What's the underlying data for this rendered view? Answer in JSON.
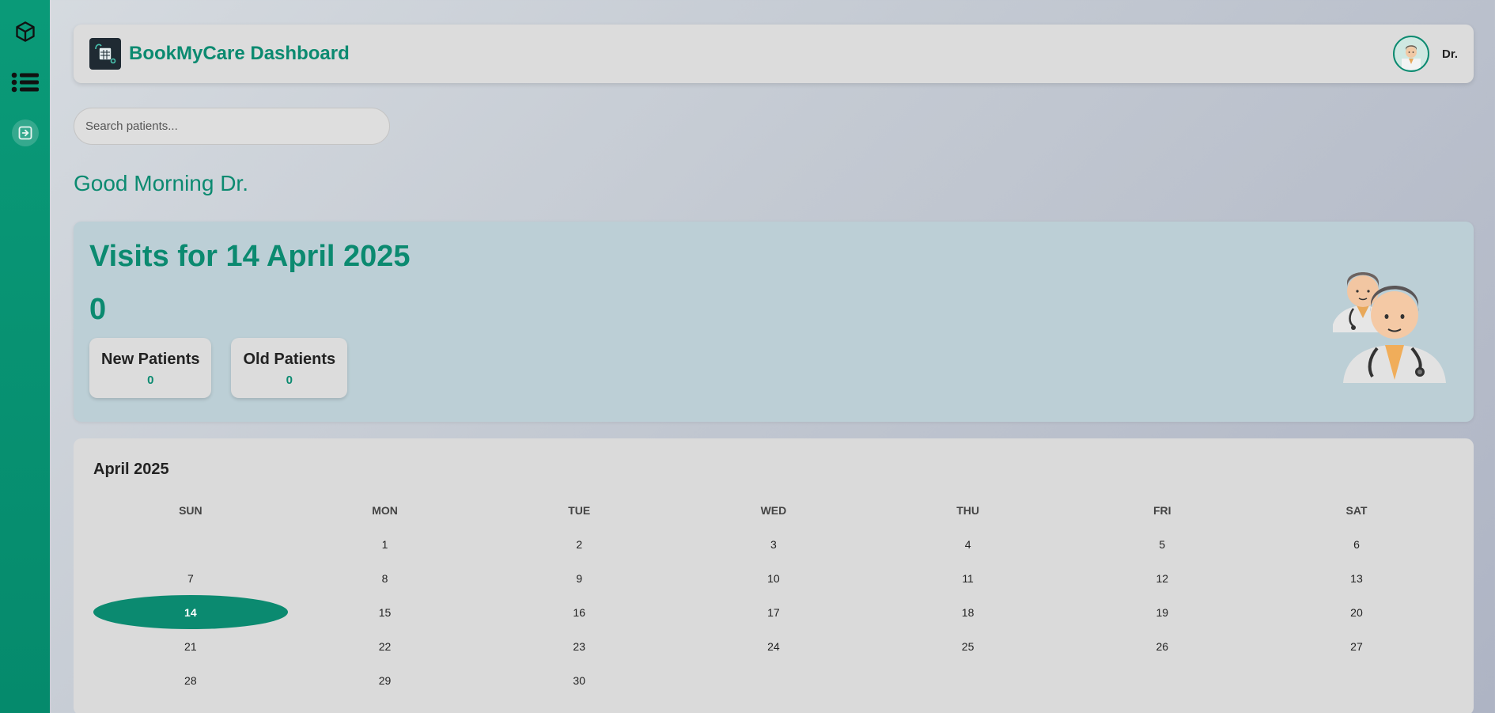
{
  "app": {
    "title": "BookMyCare Dashboard",
    "user_name": "Dr.",
    "accent": "#0b8a70"
  },
  "sidebar": {
    "items": [
      {
        "name": "cube-icon"
      },
      {
        "name": "list-icon"
      },
      {
        "name": "logout-icon"
      }
    ]
  },
  "search": {
    "placeholder": "Search patients...",
    "value": ""
  },
  "greeting": "Good Morning Dr.",
  "visits": {
    "title": "Visits for 14 April 2025",
    "count": "0",
    "new_patients": {
      "label": "New Patients",
      "value": "0"
    },
    "old_patients": {
      "label": "Old Patients",
      "value": "0"
    }
  },
  "calendar": {
    "month_label": "April 2025",
    "weekdays": [
      "SUN",
      "MON",
      "TUE",
      "WED",
      "THU",
      "FRI",
      "SAT"
    ],
    "weeks": [
      [
        "",
        "1",
        "2",
        "3",
        "4",
        "5",
        "6"
      ],
      [
        "7",
        "8",
        "9",
        "10",
        "11",
        "12",
        "13"
      ],
      [
        "14",
        "15",
        "16",
        "17",
        "18",
        "19",
        "20"
      ],
      [
        "21",
        "22",
        "23",
        "24",
        "25",
        "26",
        "27"
      ],
      [
        "28",
        "29",
        "30",
        "",
        "",
        "",
        ""
      ]
    ],
    "selected": "14"
  }
}
